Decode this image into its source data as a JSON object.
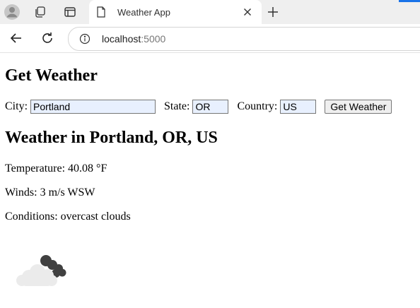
{
  "browser": {
    "tab_title": "Weather App",
    "url_host": "localhost",
    "url_port": ":5000"
  },
  "page": {
    "heading": "Get Weather",
    "form": {
      "city_label": "City:",
      "city_value": "Portland",
      "state_label": "State:",
      "state_value": "OR",
      "country_label": "Country:",
      "country_value": "US",
      "submit_label": "Get Weather"
    },
    "result": {
      "heading": "Weather in Portland, OR, US",
      "temperature": "Temperature: 40.08 °F",
      "winds": "Winds: 3 m/s WSW",
      "conditions": "Conditions: overcast clouds"
    },
    "weather_icon": "overcast-clouds-icon"
  },
  "colors": {
    "input_autofill_bg": "#e8f0fe",
    "tabstrip_bg": "#efefef",
    "accent": "#1a73e8"
  }
}
